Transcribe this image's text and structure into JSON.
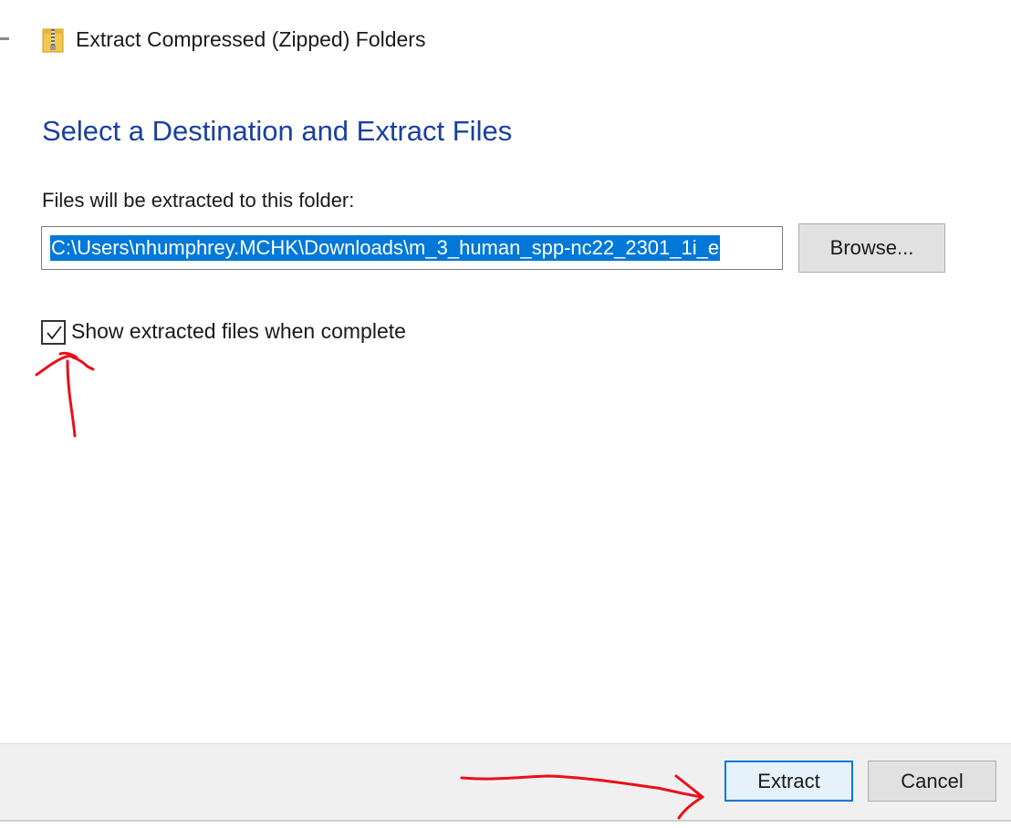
{
  "window": {
    "title": "Extract Compressed (Zipped) Folders",
    "icon": "zip-folder-icon"
  },
  "main": {
    "heading": "Select a Destination and Extract Files",
    "destination_label": "Files will be extracted to this folder:",
    "destination_path": "C:\\Users\\nhumphrey.MCHK\\Downloads\\m_3_human_spp-nc22_2301_1i_e",
    "browse_label": "Browse...",
    "show_files_checkbox": {
      "label": "Show extracted files when complete",
      "checked": true
    }
  },
  "footer": {
    "extract_label": "Extract",
    "cancel_label": "Cancel"
  },
  "colors": {
    "heading": "#1a3f9e",
    "selection": "#0078d7",
    "annotation": "#e8101a"
  }
}
